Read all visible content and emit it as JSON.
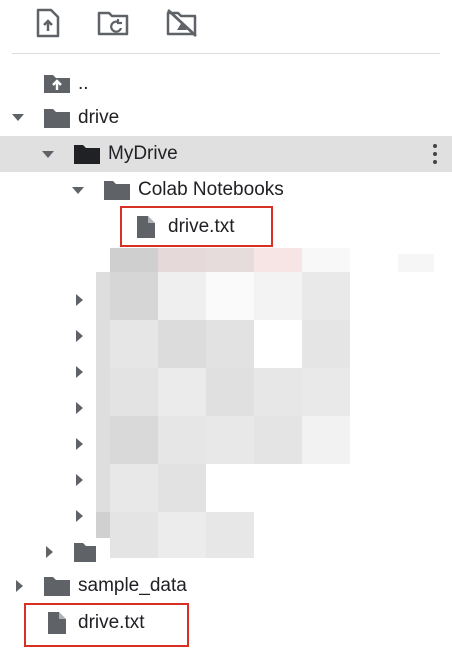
{
  "toolbar": {
    "upload_icon": "upload-file-icon",
    "refresh_icon": "folder-refresh-icon",
    "unmount_icon": "drive-off-icon"
  },
  "tree": {
    "parent": {
      "label": "..",
      "icon": "folder-up-icon"
    },
    "drive": {
      "label": "drive",
      "icon": "folder-icon"
    },
    "mydrive": {
      "label": "MyDrive",
      "icon": "folder-icon"
    },
    "colab": {
      "label": "Colab Notebooks",
      "icon": "folder-icon"
    },
    "colab_file": {
      "label": "drive.txt",
      "icon": "file-icon"
    },
    "sample": {
      "label": "sample_data",
      "icon": "folder-icon"
    },
    "root_file": {
      "label": "drive.txt",
      "icon": "file-icon"
    }
  },
  "colors": {
    "highlight_box": "#d93025",
    "selected_row": "#e0e0e0",
    "icon": "#5f6368"
  }
}
